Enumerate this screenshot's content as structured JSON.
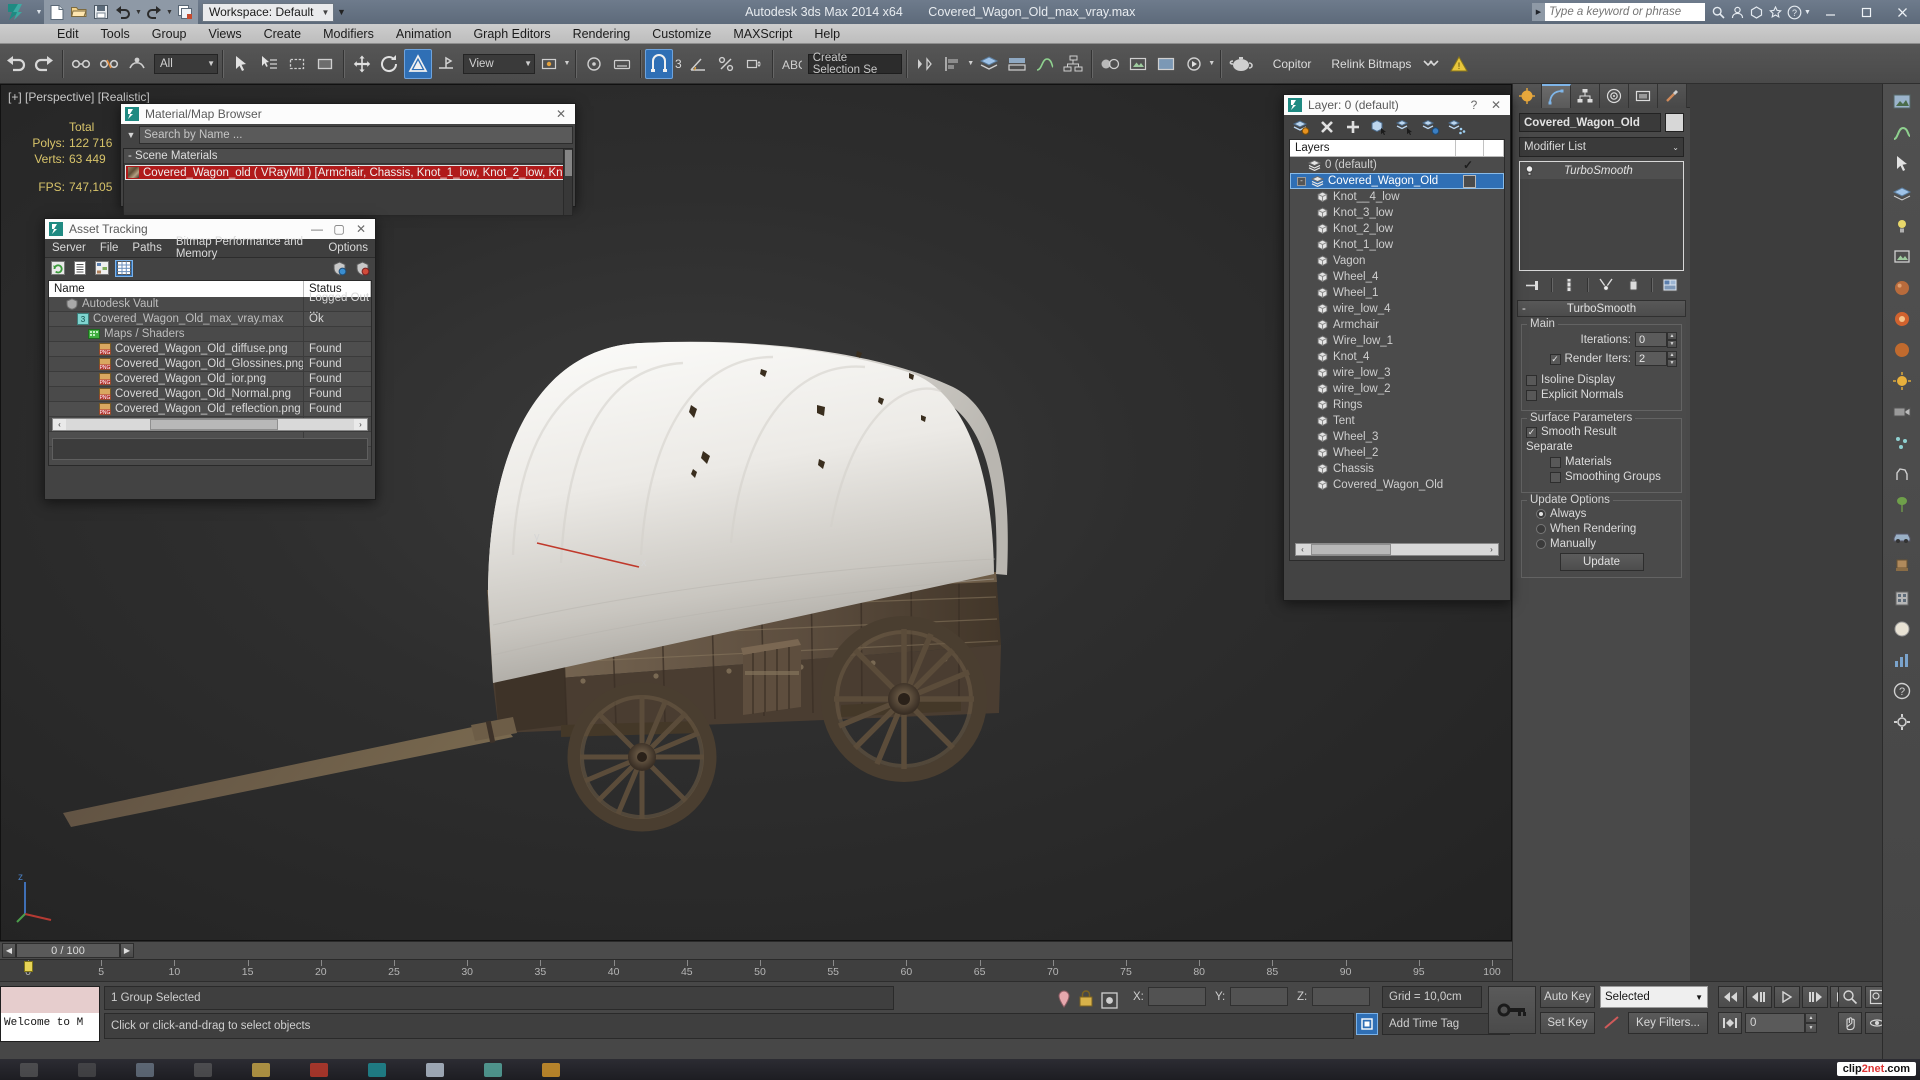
{
  "titlebar": {
    "app_title": "Autodesk 3ds Max  2014 x64",
    "file_name": "Covered_Wagon_Old_max_vray.max",
    "workspace_label": "Workspace: Default",
    "search_placeholder": "Type a keyword or phrase",
    "quick_access": [
      "new-icon",
      "open-icon",
      "save-icon",
      "undo-icon",
      "redo-icon",
      "set-project-icon"
    ],
    "window_buttons": [
      "minimize",
      "maximize",
      "close"
    ]
  },
  "menubar": {
    "items": [
      "Edit",
      "Tools",
      "Group",
      "Views",
      "Create",
      "Modifiers",
      "Animation",
      "Graph Editors",
      "Rendering",
      "Customize",
      "MAXScript",
      "Help"
    ]
  },
  "toolbar": {
    "select_filter": "All",
    "view_coord": "View",
    "selection_set_placeholder": "Create Selection Se",
    "named_buttons": [
      "Copitor",
      "Relink Bitmaps"
    ],
    "snap_value": "3"
  },
  "viewport": {
    "label": "[+] [Perspective] [Realistic]",
    "stats": {
      "total_header": "Total",
      "polys_label": "Polys:",
      "polys_value": "122 716",
      "verts_label": "Verts:",
      "verts_value": "63 449",
      "fps_label": "FPS:",
      "fps_value": "747,105"
    },
    "gizmo_axis": [
      "x",
      "y",
      "z"
    ]
  },
  "material_browser": {
    "title": "Material/Map Browser",
    "search_placeholder": "Search by Name ...",
    "group_header": "- Scene Materials",
    "material_row": "Covered_Wagon_old  ( VRayMtl ) [Armchair, Chassis, Knot_1_low, Knot_2_low, Knot_3_low, Knot..."
  },
  "asset_tracking": {
    "title": "Asset Tracking",
    "menu": [
      "Server",
      "File",
      "Paths",
      "Bitmap Performance and Memory",
      "Options"
    ],
    "columns": [
      "Name",
      "Status"
    ],
    "rows": [
      {
        "indent": 1,
        "icon": "vault-icon",
        "name": "Autodesk Vault",
        "status": "Logged Out ..."
      },
      {
        "indent": 2,
        "icon": "max-icon",
        "name": "Covered_Wagon_Old_max_vray.max",
        "status": "Ok"
      },
      {
        "indent": 3,
        "icon": "maps-icon",
        "name": "Maps / Shaders",
        "status": ""
      },
      {
        "indent": 4,
        "icon": "png-icon",
        "name": "Covered_Wagon_Old_diffuse.png",
        "status": "Found"
      },
      {
        "indent": 4,
        "icon": "png-icon",
        "name": "Covered_Wagon_Old_Glossines.png",
        "status": "Found"
      },
      {
        "indent": 4,
        "icon": "png-icon",
        "name": "Covered_Wagon_Old_ior.png",
        "status": "Found"
      },
      {
        "indent": 4,
        "icon": "png-icon",
        "name": "Covered_Wagon_Old_Normal.png",
        "status": "Found"
      },
      {
        "indent": 4,
        "icon": "png-icon",
        "name": "Covered_Wagon_Old_reflection.png",
        "status": "Found"
      }
    ],
    "toolbar_icons": [
      "refresh-icon",
      "list-icon",
      "tree-icon",
      "grid-icon"
    ],
    "right_icons": [
      "vault-login-icon",
      "vault-settings-icon"
    ]
  },
  "layer_dialog": {
    "title": "Layer: 0 (default)",
    "help_label": "?",
    "close_label": "✕",
    "column_header": "Layers",
    "toolbar_icons": [
      "new-layer-icon",
      "delete-layer-icon",
      "add-layer-icon",
      "select-objects-icon",
      "select-highlighted-icon",
      "highlight-selected-icon",
      "hide-layer-icon"
    ],
    "rows": [
      {
        "name": "0 (default)",
        "type": "layer",
        "indent": 0,
        "selected": false,
        "mark": "check"
      },
      {
        "name": "Covered_Wagon_Old",
        "type": "layer",
        "indent": 0,
        "selected": true,
        "mark": "box",
        "expander": "-"
      },
      {
        "name": "Knot__4_low",
        "type": "object",
        "indent": 1,
        "selected": false,
        "mark": ""
      },
      {
        "name": "Knot_3_low",
        "type": "object",
        "indent": 1,
        "selected": false,
        "mark": ""
      },
      {
        "name": "Knot_2_low",
        "type": "object",
        "indent": 1,
        "selected": false,
        "mark": ""
      },
      {
        "name": "Knot_1_low",
        "type": "object",
        "indent": 1,
        "selected": false,
        "mark": ""
      },
      {
        "name": "Vagon",
        "type": "object",
        "indent": 1,
        "selected": false,
        "mark": ""
      },
      {
        "name": "Wheel_4",
        "type": "object",
        "indent": 1,
        "selected": false,
        "mark": ""
      },
      {
        "name": "Wheel_1",
        "type": "object",
        "indent": 1,
        "selected": false,
        "mark": ""
      },
      {
        "name": "wire_low_4",
        "type": "object",
        "indent": 1,
        "selected": false,
        "mark": ""
      },
      {
        "name": "Armchair",
        "type": "object",
        "indent": 1,
        "selected": false,
        "mark": ""
      },
      {
        "name": "Wire_low_1",
        "type": "object",
        "indent": 1,
        "selected": false,
        "mark": ""
      },
      {
        "name": "Knot_4",
        "type": "object",
        "indent": 1,
        "selected": false,
        "mark": ""
      },
      {
        "name": "wire_low_3",
        "type": "object",
        "indent": 1,
        "selected": false,
        "mark": ""
      },
      {
        "name": "wire_low_2",
        "type": "object",
        "indent": 1,
        "selected": false,
        "mark": ""
      },
      {
        "name": "Rings",
        "type": "object",
        "indent": 1,
        "selected": false,
        "mark": ""
      },
      {
        "name": "Tent",
        "type": "object",
        "indent": 1,
        "selected": false,
        "mark": ""
      },
      {
        "name": "Wheel_3",
        "type": "object",
        "indent": 1,
        "selected": false,
        "mark": ""
      },
      {
        "name": "Wheel_2",
        "type": "object",
        "indent": 1,
        "selected": false,
        "mark": ""
      },
      {
        "name": "Chassis",
        "type": "object",
        "indent": 1,
        "selected": false,
        "mark": ""
      },
      {
        "name": "Covered_Wagon_Old",
        "type": "object",
        "indent": 1,
        "selected": false,
        "mark": ""
      }
    ]
  },
  "command_panel": {
    "tabs": [
      "create-tab",
      "modify-tab",
      "hierarchy-tab",
      "motion-tab",
      "display-tab",
      "utilities-tab"
    ],
    "active_tab_index": 1,
    "object_name": "Covered_Wagon_Old",
    "modifier_list_label": "Modifier List",
    "modifier_stack": [
      {
        "name": "TurboSmooth",
        "light": true
      }
    ],
    "stack_buttons": [
      "pin-stack-icon",
      "show-end-result-icon",
      "make-unique-icon",
      "remove-modifier-icon",
      "configure-sets-icon"
    ],
    "turbosmooth": {
      "rollout_title": "TurboSmooth",
      "collapse_glyph": "-",
      "main_group": "Main",
      "iterations_label": "Iterations:",
      "iterations_value": "0",
      "render_iters_label": "Render Iters:",
      "render_iters_value": "2",
      "render_iters_checked": true,
      "isoline_label": "Isoline Display",
      "isoline_checked": false,
      "explicit_normals_label": "Explicit Normals",
      "explicit_normals_checked": false,
      "surface_group": "Surface Parameters",
      "smooth_result_label": "Smooth Result",
      "smooth_result_checked": true,
      "separate_label": "Separate",
      "materials_label": "Materials",
      "materials_checked": false,
      "smoothing_groups_label": "Smoothing Groups",
      "smoothing_groups_checked": false,
      "update_group": "Update Options",
      "update_options": [
        "Always",
        "When Rendering",
        "Manually"
      ],
      "update_selected_index": 0,
      "update_button": "Update"
    }
  },
  "timeline": {
    "frame_display": "0 / 100",
    "ticks": [
      0,
      5,
      10,
      15,
      20,
      25,
      30,
      35,
      40,
      45,
      50,
      55,
      60,
      65,
      70,
      75,
      80,
      85,
      90,
      95,
      100
    ],
    "current_frame": 0
  },
  "statusbar": {
    "maxlistener_text": "Welcome to M",
    "selection_status": "1 Group Selected",
    "prompt": "Click or click-and-drag to select objects",
    "x_label": "X:",
    "x_value": "",
    "y_label": "Y:",
    "y_value": "",
    "z_label": "Z:",
    "z_value": "",
    "grid_label": "Grid = 10,0cm",
    "add_time_tag": "Add Time Tag",
    "auto_key": "Auto Key",
    "set_key": "Set Key",
    "key_mode_value": "Selected",
    "key_filters": "Key Filters...",
    "current_key_frame": "0"
  },
  "taskbar": {
    "watermark_text": "clip",
    "watermark_net": "2net",
    "watermark_dom": ".com"
  },
  "colors": {
    "accent_blue": "#2f6fb5",
    "title_gradient_top": "#6e7b8c",
    "stat_yellow": "#d8c46a",
    "panel_bg": "#494949",
    "selection_red": "#b01a1a"
  }
}
